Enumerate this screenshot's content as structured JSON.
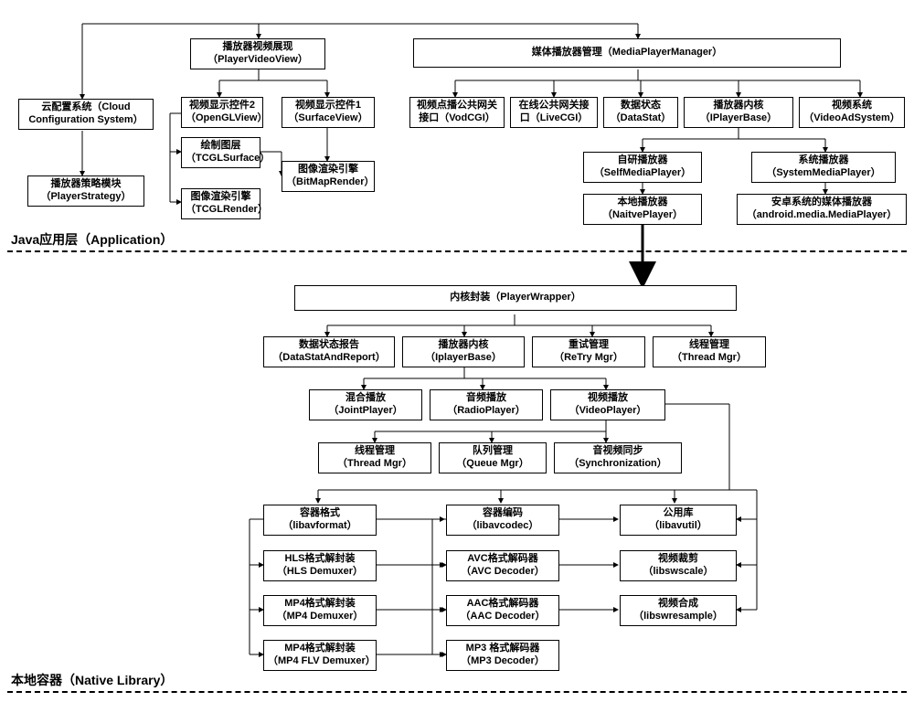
{
  "layers": {
    "app": "Java应用层（Application）",
    "native": "本地容器（Native Library）"
  },
  "top": {
    "cloud": {
      "l1": "云配置系统（Cloud",
      "l2": "Configuration System）"
    },
    "strategy": {
      "l1": "播放器策略模块",
      "l2": "（PlayerStrategy）"
    },
    "videoView": {
      "l1": "播放器视频展现",
      "l2": "（PlayerVideoView）"
    },
    "openGL": {
      "l1": "视频显示控件2",
      "l2": "（OpenGLView）"
    },
    "surface": {
      "l1": "视频显示控件1",
      "l2": "（SurfaceView）"
    },
    "tcglSurf": {
      "l1": "绘制图层",
      "l2": "（TCGLSurface）"
    },
    "tcglRend": {
      "l1": "图像渲染引擎",
      "l2": "（TCGLRender）"
    },
    "bmpRend": {
      "l1": "图像渲染引擎",
      "l2": "（BitMapRender）"
    },
    "mpm": "媒体播放器管理（MediaPlayerManager）",
    "vodcgi": {
      "l1": "视频点播公共网关",
      "l2": "接口（VodCGI）"
    },
    "livecgi": {
      "l1": "在线公共网关接",
      "l2": "口（LiveCGI）"
    },
    "datastat": {
      "l1": "数据状态",
      "l2": "（DataStat）"
    },
    "iplayerbase": {
      "l1": "播放器内核",
      "l2": "（IPlayerBase）"
    },
    "videoad": {
      "l1": "视频系统",
      "l2": "（VideoAdSystem）"
    },
    "selfmp": {
      "l1": "自研播放器",
      "l2": "（SelfMediaPlayer）"
    },
    "sysmp": {
      "l1": "系统播放器",
      "l2": "（SystemMediaPlayer）"
    },
    "nativep": {
      "l1": "本地播放器",
      "l2": "（NaitvePlayer）"
    },
    "andmp": {
      "l1": "安卓系统的媒体播放器",
      "l2": "（android.media.MediaPlayer）"
    }
  },
  "mid": {
    "wrapper": "内核封装（PlayerWrapper）",
    "dataRep": {
      "l1": "数据状态报告",
      "l2": "（DataStatAndReport）"
    },
    "ipb": {
      "l1": "播放器内核",
      "l2": "（IplayerBase）"
    },
    "retry": {
      "l1": "重试管理",
      "l2": "（ReTry Mgr）"
    },
    "thread": {
      "l1": "线程管理",
      "l2": "（Thread Mgr）"
    },
    "joint": {
      "l1": "混合播放",
      "l2": "（JointPlayer）"
    },
    "radio": {
      "l1": "音频播放",
      "l2": "（RadioPlayer）"
    },
    "video": {
      "l1": "视频播放",
      "l2": "（VideoPlayer）"
    },
    "thread2": {
      "l1": "线程管理",
      "l2": "（Thread Mgr）"
    },
    "queue": {
      "l1": "队列管理",
      "l2": "（Queue Mgr）"
    },
    "sync": {
      "l1": "音视频同步",
      "l2": "（Synchronization）"
    }
  },
  "bot": {
    "libavformat": {
      "l1": "容器格式",
      "l2": "（libavformat）"
    },
    "hls": {
      "l1": "HLS格式解封装",
      "l2": "（HLS Demuxer）"
    },
    "mp4": {
      "l1": "MP4格式解封装",
      "l2": "（MP4 Demuxer）"
    },
    "mp4flv": {
      "l1": "MP4格式解封装",
      "l2": "（MP4 FLV Demuxer）"
    },
    "libavcodec": {
      "l1": "容器编码",
      "l2": "（libavcodec）"
    },
    "avc": {
      "l1": "AVC格式解码器",
      "l2": "（AVC Decoder）"
    },
    "aac": {
      "l1": "AAC格式解码器",
      "l2": "（AAC Decoder）"
    },
    "mp3": {
      "l1": "MP3 格式解码器",
      "l2": "（MP3 Decoder）"
    },
    "libavutil": {
      "l1": "公用库",
      "l2": "（libavutil）"
    },
    "libswscale": {
      "l1": "视频裁剪",
      "l2": "（libswscale）"
    },
    "libswresample": {
      "l1": "视频合成",
      "l2": "（libswresample）"
    }
  }
}
